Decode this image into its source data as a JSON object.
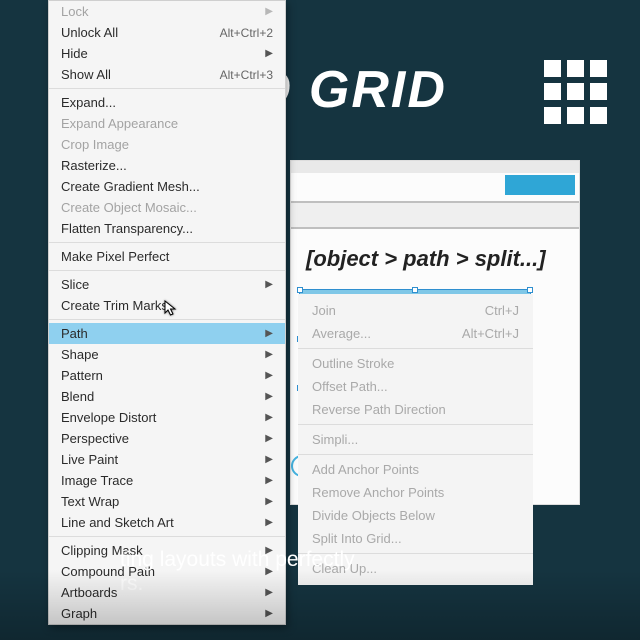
{
  "header": {
    "title": "O GRID"
  },
  "caption": {
    "line1": "ting layouts with perfectly",
    "line2": "rs."
  },
  "breadcrumb": "[object > path > split...]",
  "menu": [
    {
      "label": "Lock",
      "shortcut": "",
      "sub": true,
      "dis": true
    },
    {
      "label": "Unlock All",
      "shortcut": "Alt+Ctrl+2"
    },
    {
      "label": "Hide",
      "shortcut": "",
      "sub": true
    },
    {
      "label": "Show All",
      "shortcut": "Alt+Ctrl+3"
    },
    {
      "sep": true
    },
    {
      "label": "Expand..."
    },
    {
      "label": "Expand Appearance",
      "dis": true
    },
    {
      "label": "Crop Image",
      "dis": true
    },
    {
      "label": "Rasterize..."
    },
    {
      "label": "Create Gradient Mesh..."
    },
    {
      "label": "Create Object Mosaic...",
      "dis": true
    },
    {
      "label": "Flatten Transparency..."
    },
    {
      "sep": true
    },
    {
      "label": "Make Pixel Perfect"
    },
    {
      "sep": true
    },
    {
      "label": "Slice",
      "sub": true
    },
    {
      "label": "Create Trim Marks"
    },
    {
      "sep": true
    },
    {
      "label": "Path",
      "sub": true,
      "sel": true
    },
    {
      "label": "Shape",
      "sub": true
    },
    {
      "label": "Pattern",
      "sub": true
    },
    {
      "label": "Blend",
      "sub": true
    },
    {
      "label": "Envelope Distort",
      "sub": true
    },
    {
      "label": "Perspective",
      "sub": true
    },
    {
      "label": "Live Paint",
      "sub": true
    },
    {
      "label": "Image Trace",
      "sub": true
    },
    {
      "label": "Text Wrap",
      "sub": true
    },
    {
      "label": "Line and Sketch Art",
      "sub": true
    },
    {
      "sep": true
    },
    {
      "label": "Clipping Mask",
      "sub": true
    },
    {
      "label": "Compound Path",
      "sub": true
    },
    {
      "label": "Artboards",
      "sub": true
    },
    {
      "label": "Graph",
      "sub": true
    }
  ],
  "submenu": [
    {
      "label": "Join",
      "shortcut": "Ctrl+J"
    },
    {
      "label": "Average...",
      "shortcut": "Alt+Ctrl+J"
    },
    {
      "sep": true
    },
    {
      "label": "Outline Stroke"
    },
    {
      "label": "Offset Path..."
    },
    {
      "label": "Reverse Path Direction"
    },
    {
      "sep": true
    },
    {
      "label": "Simpli..."
    },
    {
      "sep": true
    },
    {
      "label": "Add Anchor Points"
    },
    {
      "label": "Remove Anchor Points"
    },
    {
      "label": "Divide Objects Below"
    },
    {
      "label": "Split Into Grid..."
    },
    {
      "sep": true
    },
    {
      "label": "Clean Up..."
    }
  ]
}
